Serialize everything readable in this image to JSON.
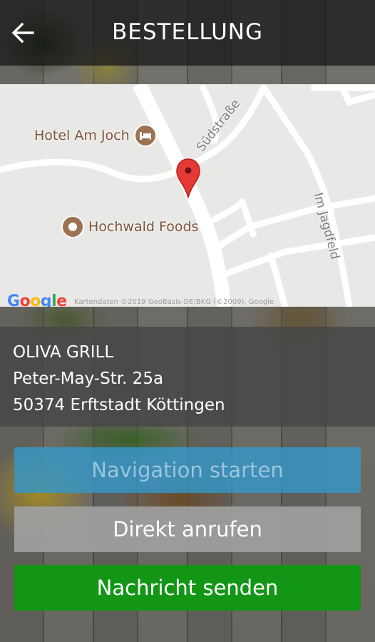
{
  "header": {
    "title": "BESTELLUNG",
    "back_icon": "arrow-left-icon"
  },
  "map": {
    "pois": [
      {
        "label": "Hotel Am Joch",
        "icon": "hotel-bed-icon"
      },
      {
        "label": "Hochwald Foods",
        "icon": "place-dot-icon"
      }
    ],
    "streets": [
      "Südstraße",
      "Im Jagdfeld"
    ],
    "logo": "Google",
    "attribution": "Kartendaten ©2019 GeoBasis-DE/BKG (©2009), Google",
    "marker_color": "#e53935"
  },
  "restaurant": {
    "name": "OLIVA GRILL",
    "street": "Peter-May-Str. 25a",
    "city": "50374 Erftstadt Köttingen"
  },
  "actions": {
    "navigate_label": "Navigation starten",
    "call_label": "Direkt anrufen",
    "message_label": "Nachricht senden"
  },
  "colors": {
    "navigate": "#3596c8",
    "call": "#a0a0a0",
    "message": "#139616"
  }
}
